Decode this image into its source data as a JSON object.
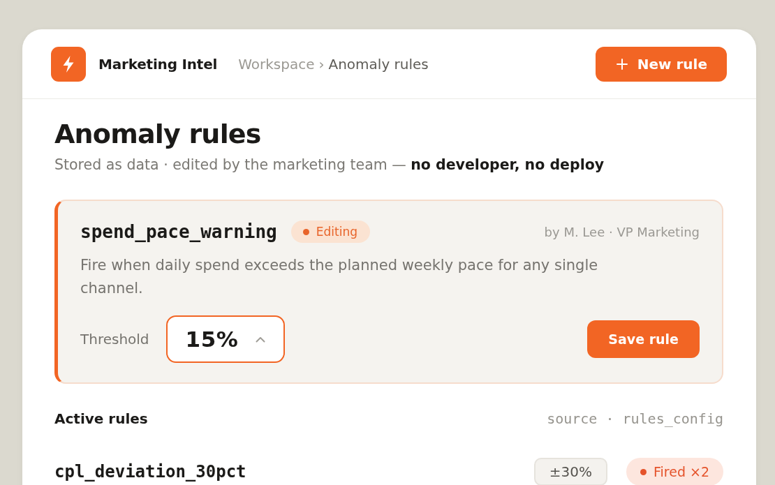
{
  "header": {
    "app_name": "Marketing Intel",
    "breadcrumb": [
      {
        "label": "Workspace",
        "current": false
      },
      {
        "label": "Anomaly rules",
        "current": true
      }
    ],
    "breadcrumb_separator": "›",
    "new_button": "New rule"
  },
  "page": {
    "title": "Anomaly rules",
    "subtitle": "Stored as data · edited by the marketing team — **no developer, no deploy**"
  },
  "editor": {
    "name": "spend_pace_warning",
    "status": {
      "kind": "editing",
      "label": "Editing"
    },
    "author": "by M. Lee · VP Marketing",
    "description": "Fire when daily spend exceeds the planned weekly pace for any single channel.",
    "threshold": {
      "label": "Threshold",
      "value": "15%",
      "focused": true
    },
    "save_button": "Save rule"
  },
  "active_rules": {
    "title": "Active rules",
    "source": "source · rules_config",
    "rows": [
      {
        "name": "cpl_deviation_30pct",
        "threshold": "±30%",
        "status": {
          "kind": "fired",
          "label": "Fired ×2"
        }
      }
    ]
  }
}
